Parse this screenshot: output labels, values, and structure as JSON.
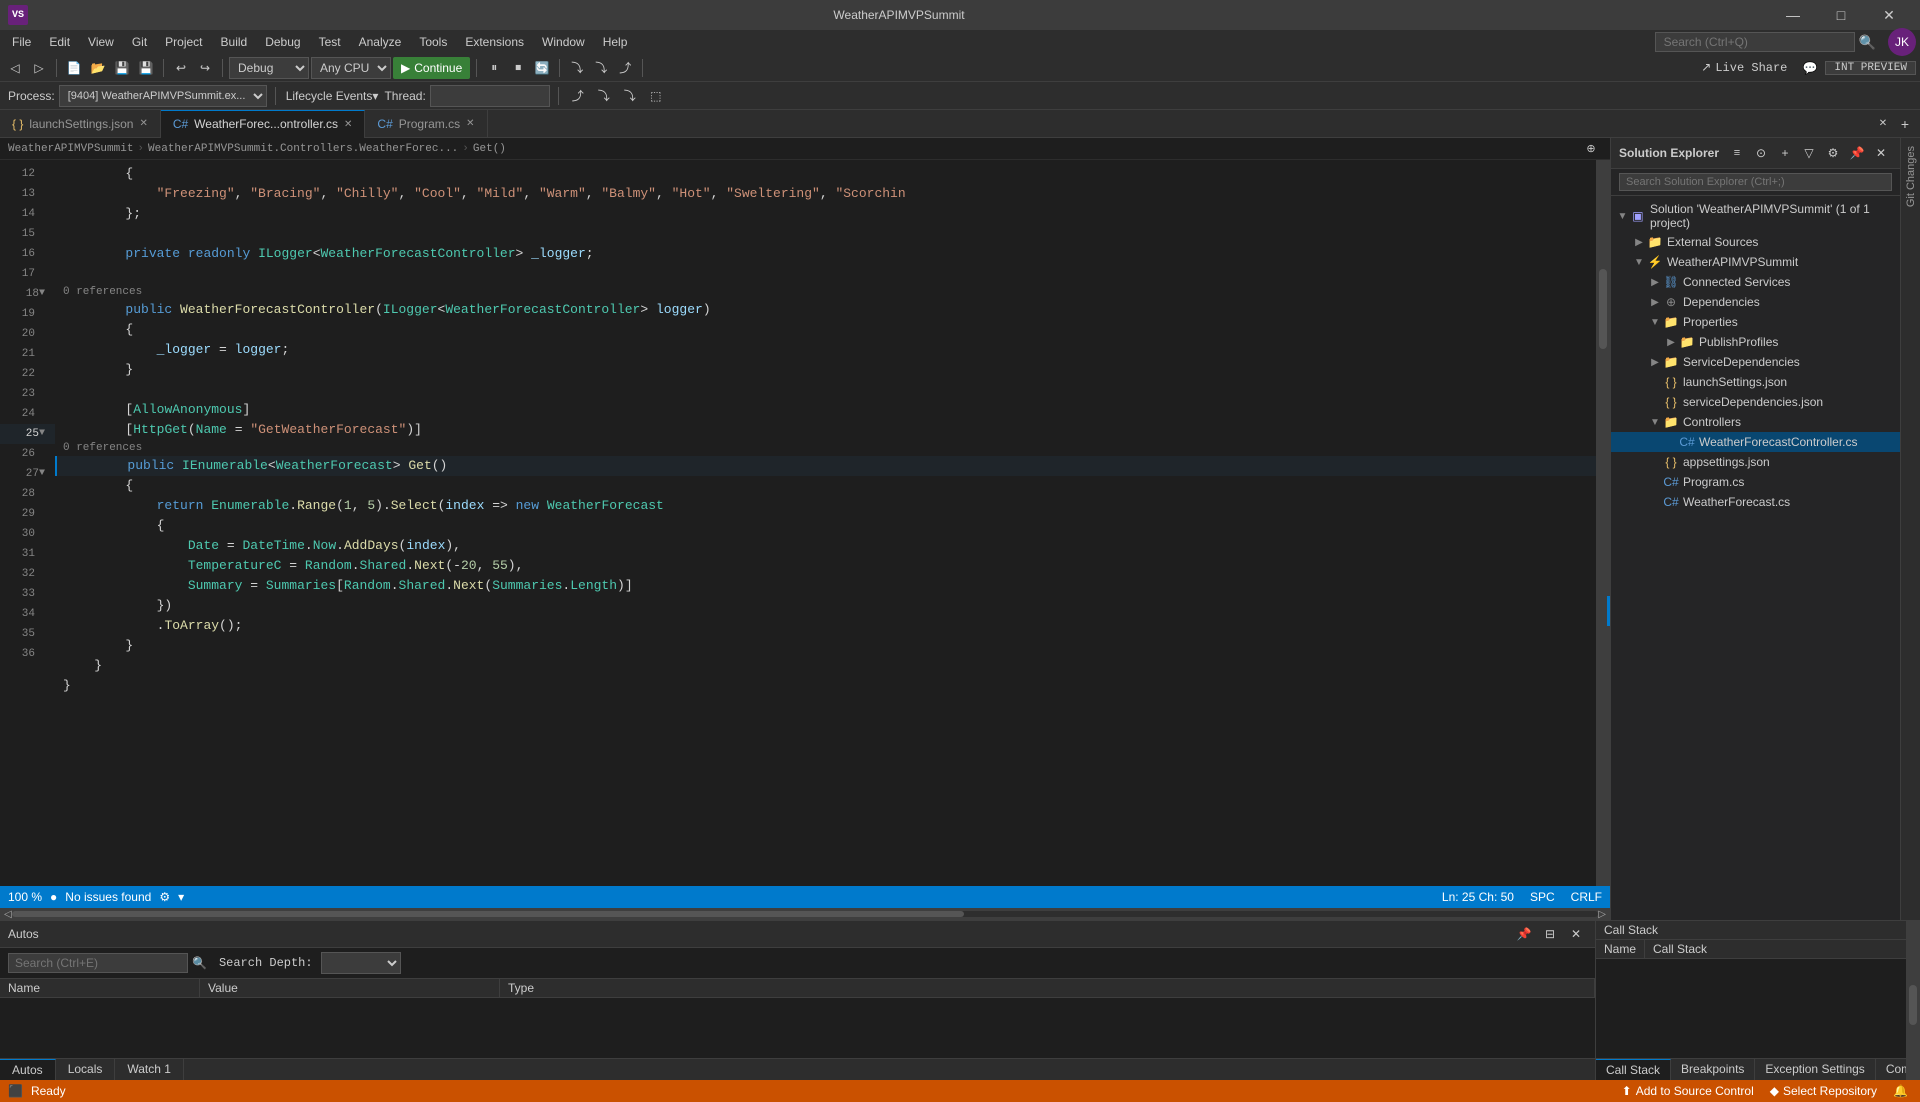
{
  "titleBar": {
    "appName": "WeatherAPIMVPSummit",
    "logoText": "VS",
    "minimize": "—",
    "maximize": "□",
    "close": "✕"
  },
  "menuBar": {
    "items": [
      "File",
      "Edit",
      "View",
      "Git",
      "Project",
      "Build",
      "Debug",
      "Test",
      "Analyze",
      "Tools",
      "Extensions",
      "Window",
      "Help"
    ]
  },
  "toolbar": {
    "debugConfig": "Debug",
    "platform": "Any CPU",
    "continueBtn": "Continue",
    "liveShare": "Live Share",
    "intPreview": "INT PREVIEW",
    "searchPlaceholder": "Search (Ctrl+Q)"
  },
  "debugBar": {
    "processLabel": "Process:",
    "processValue": "[9404] WeatherAPIMVPSummit.ex...",
    "lifecycleLabel": "Lifecycle Events",
    "threadLabel": "Thread:"
  },
  "tabs": [
    {
      "label": "launchSettings.json",
      "type": "json",
      "active": false
    },
    {
      "label": "WeatherForec...ontroller.cs",
      "type": "cs",
      "active": true
    },
    {
      "label": "Program.cs",
      "type": "cs",
      "active": false
    }
  ],
  "breadcrumb": {
    "project": "WeatherAPIMVPSummit",
    "namespace": "WeatherAPIMVPSummit.Controllers.WeatherForec...",
    "member": "Get()"
  },
  "code": {
    "lines": [
      {
        "num": 12,
        "fold": false,
        "indent": 0,
        "content": "        {"
      },
      {
        "num": 13,
        "fold": false,
        "indent": 0,
        "content": "            \"Freezing\", \"Bracing\", \"Chilly\", \"Cool\", \"Mild\", \"Warm\", \"Balmy\", \"Hot\", \"Sweltering\", \"Scorchin"
      },
      {
        "num": 14,
        "fold": false,
        "indent": 0,
        "content": "        };"
      },
      {
        "num": 15,
        "fold": false,
        "indent": 0,
        "content": ""
      },
      {
        "num": 16,
        "fold": false,
        "indent": 0,
        "content": "        private readonly ILogger<WeatherForecastController> _logger;"
      },
      {
        "num": 17,
        "fold": false,
        "indent": 0,
        "content": ""
      },
      {
        "num": 18,
        "fold": true,
        "indent": 0,
        "refHint": "0 references",
        "content": "        public WeatherForecastController(ILogger<WeatherForecastController> logger)"
      },
      {
        "num": 19,
        "fold": false,
        "indent": 0,
        "content": "        {"
      },
      {
        "num": 20,
        "fold": false,
        "indent": 0,
        "content": "            _logger = logger;"
      },
      {
        "num": 21,
        "fold": false,
        "indent": 0,
        "content": "        }"
      },
      {
        "num": 22,
        "fold": false,
        "indent": 0,
        "content": ""
      },
      {
        "num": 23,
        "fold": false,
        "indent": 0,
        "content": "        [AllowAnonymous]"
      },
      {
        "num": 24,
        "fold": false,
        "indent": 0,
        "content": "        [HttpGet(Name = \"GetWeatherForecast\")]"
      },
      {
        "num": 25,
        "fold": true,
        "indent": 0,
        "refHint": "0 references",
        "current": true,
        "content": "        public IEnumerable<WeatherForecast> Get()"
      },
      {
        "num": 26,
        "fold": false,
        "indent": 0,
        "content": "        {"
      },
      {
        "num": 27,
        "fold": true,
        "indent": 0,
        "content": "            return Enumerable.Range(1, 5).Select(index => new WeatherForecast"
      },
      {
        "num": 28,
        "fold": false,
        "indent": 0,
        "content": "            {"
      },
      {
        "num": 29,
        "fold": false,
        "indent": 0,
        "content": "                Date = DateTime.Now.AddDays(index),"
      },
      {
        "num": 30,
        "fold": false,
        "indent": 0,
        "content": "                TemperatureC = Random.Shared.Next(-20, 55),"
      },
      {
        "num": 31,
        "fold": false,
        "indent": 0,
        "content": "                Summary = Summaries[Random.Shared.Next(Summaries.Length)]"
      },
      {
        "num": 32,
        "fold": false,
        "indent": 0,
        "content": "            })"
      },
      {
        "num": 33,
        "fold": false,
        "indent": 0,
        "content": "            .ToArray();"
      },
      {
        "num": 34,
        "fold": false,
        "indent": 0,
        "content": "        }"
      },
      {
        "num": 35,
        "fold": false,
        "indent": 0,
        "content": "    }"
      },
      {
        "num": 36,
        "fold": false,
        "indent": 0,
        "content": "}"
      }
    ]
  },
  "statusLine": {
    "zoomLevel": "100 %",
    "issues": "No issues found",
    "lineCol": "Ln: 25  Ch: 50",
    "encoding": "SPC",
    "lineEnding": "CRLF"
  },
  "solutionExplorer": {
    "title": "Solution Explorer",
    "searchPlaceholder": "Search Solution Explorer (Ctrl+;)",
    "tree": [
      {
        "level": 0,
        "icon": "solution",
        "label": "Solution 'WeatherAPIMVPSummit' (1 of 1 project)",
        "expanded": true
      },
      {
        "level": 1,
        "icon": "folder",
        "label": "External Sources",
        "expanded": false
      },
      {
        "level": 1,
        "icon": "proj",
        "label": "WeatherAPIMVPSummit",
        "expanded": true
      },
      {
        "level": 2,
        "icon": "folder",
        "label": "Connected Services",
        "expanded": false
      },
      {
        "level": 2,
        "icon": "folder",
        "label": "Dependencies",
        "expanded": false
      },
      {
        "level": 2,
        "icon": "folder",
        "label": "Properties",
        "expanded": true
      },
      {
        "level": 3,
        "icon": "folder",
        "label": "PublishProfiles",
        "expanded": false
      },
      {
        "level": 2,
        "icon": "folder",
        "label": "ServiceDependencies",
        "expanded": false
      },
      {
        "level": 2,
        "icon": "json",
        "label": "launchSettings.json",
        "expanded": false
      },
      {
        "level": 2,
        "icon": "json",
        "label": "serviceDependencies.json",
        "expanded": false
      },
      {
        "level": 2,
        "icon": "folder",
        "label": "Controllers",
        "expanded": true
      },
      {
        "level": 3,
        "icon": "cs",
        "label": "WeatherForecastController.cs",
        "selected": true,
        "expanded": false
      },
      {
        "level": 2,
        "icon": "json",
        "label": "appsettings.json",
        "expanded": false
      },
      {
        "level": 2,
        "icon": "cs",
        "label": "Program.cs",
        "expanded": false
      },
      {
        "level": 2,
        "icon": "cs",
        "label": "WeatherForecast.cs",
        "expanded": false
      }
    ]
  },
  "bottomPanel": {
    "autosTitle": "Autos",
    "searchPlaceholder": "Search (Ctrl+E)",
    "searchDepthLabel": "Search Depth:",
    "columns": {
      "name": "Name",
      "value": "Value",
      "type": "Type"
    },
    "tabs": [
      "Autos",
      "Locals",
      "Watch 1"
    ],
    "callStackTitle": "Call Stack",
    "callStackColumns": {
      "name": "Name",
      "callStack": "Call Stack"
    },
    "callStackTabs": [
      "Call Stack",
      "Breakpoints",
      "Exception Settings",
      "Command Win..."
    ]
  },
  "statusBar": {
    "ready": "Ready",
    "addToSourceControl": "Add to Source Control",
    "selectRepository": "Select Repository"
  }
}
